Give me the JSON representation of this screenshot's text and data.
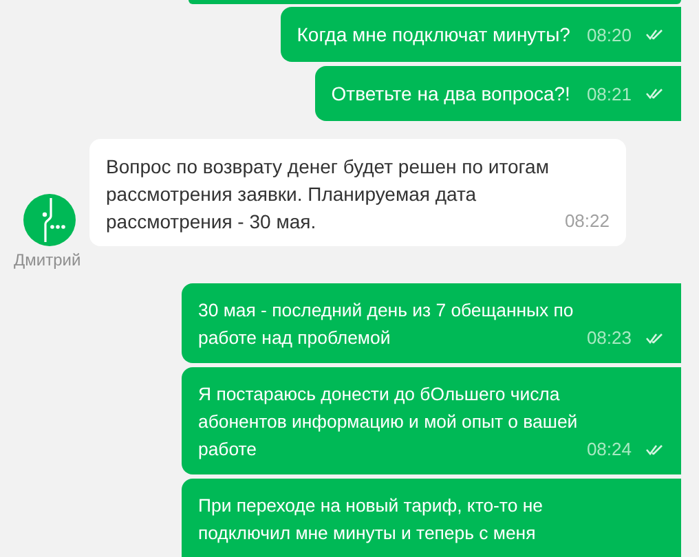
{
  "messages": [
    {
      "kind": "outgoing",
      "text": "Когда мне подключат минуты?",
      "time": "08:20",
      "read": true
    },
    {
      "kind": "outgoing",
      "text": "Ответьте на два вопроса?!",
      "time": "08:21",
      "read": true
    },
    {
      "kind": "incoming",
      "sender": "Дмитрий",
      "text": "Вопрос по возврату денег будет решен по итогам рассмотрения заявки. Планируемая дата рассмотрения - 30 мая.",
      "time": "08:22"
    },
    {
      "kind": "outgoing",
      "text": "30 мая - последний день из 7 обещанных по работе над проблемой",
      "time": "08:23",
      "read": true
    },
    {
      "kind": "outgoing",
      "text": "Я постараюсь донести до бОльшего числа абонентов информацию и мой опыт о вашей работе",
      "time": "08:24",
      "read": true
    },
    {
      "kind": "outgoing",
      "text": "При переходе на новый тариф, кто-то не подключил мне минуты и теперь с меня"
    }
  ]
}
